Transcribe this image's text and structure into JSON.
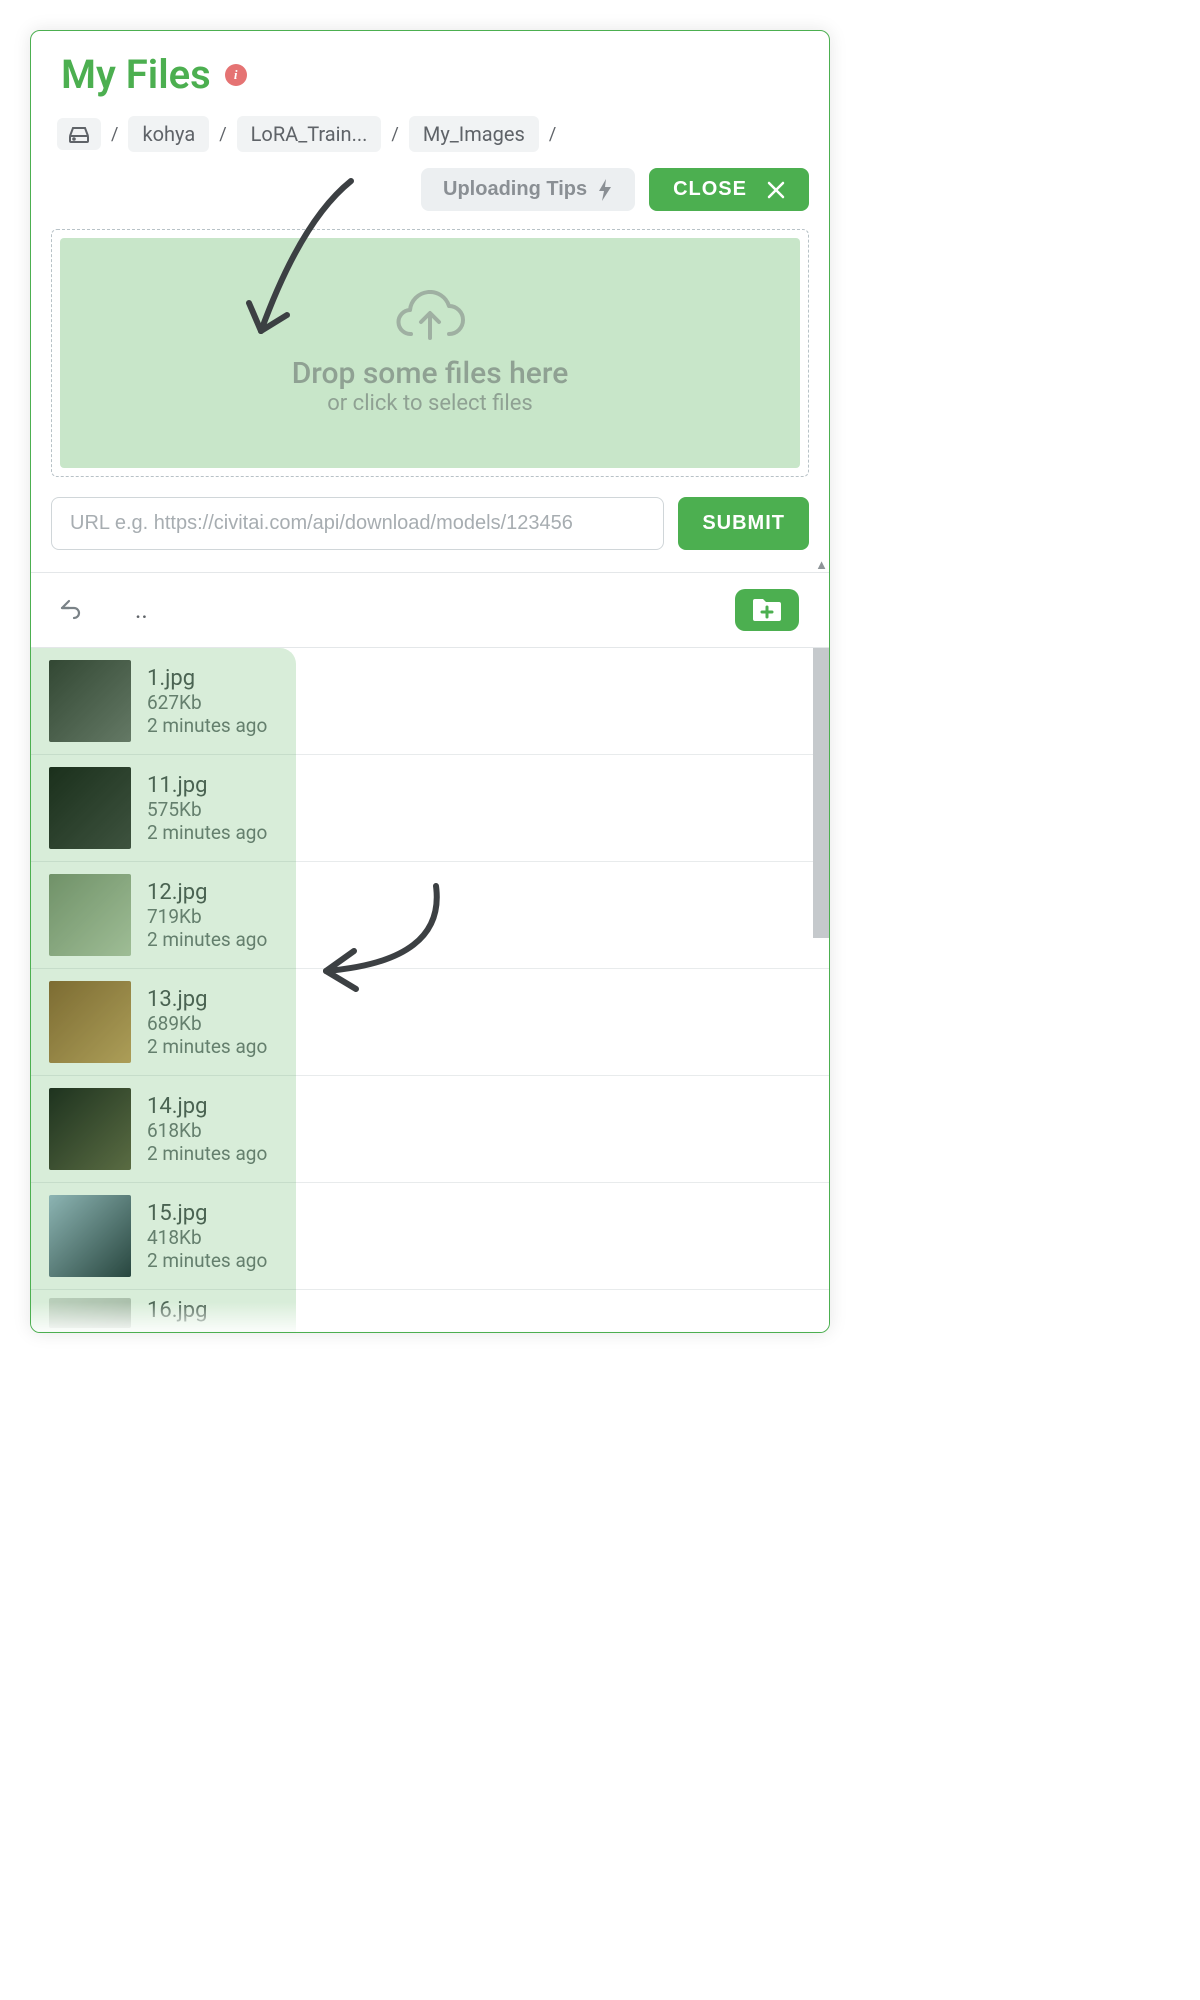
{
  "header": {
    "title": "My Files",
    "info_icon": "i"
  },
  "breadcrumb": {
    "items": [
      "kohya",
      "LoRA_Train...",
      "My_Images"
    ]
  },
  "actions": {
    "tips_label": "Uploading Tips",
    "close_label": "CLOSE"
  },
  "dropzone": {
    "main": "Drop some files here",
    "sub": "or click to select files"
  },
  "url": {
    "placeholder": "URL e.g. https://civitai.com/api/download/models/123456",
    "submit_label": "SUBMIT"
  },
  "browser": {
    "parent_label": ".."
  },
  "files": [
    {
      "name": "1.jpg",
      "size": "627Kb",
      "time": "2 minutes ago"
    },
    {
      "name": "11.jpg",
      "size": "575Kb",
      "time": "2 minutes ago"
    },
    {
      "name": "12.jpg",
      "size": "719Kb",
      "time": "2 minutes ago"
    },
    {
      "name": "13.jpg",
      "size": "689Kb",
      "time": "2 minutes ago"
    },
    {
      "name": "14.jpg",
      "size": "618Kb",
      "time": "2 minutes ago"
    },
    {
      "name": "15.jpg",
      "size": "418Kb",
      "time": "2 minutes ago"
    },
    {
      "name": "16.jpg",
      "size": "",
      "time": ""
    }
  ]
}
